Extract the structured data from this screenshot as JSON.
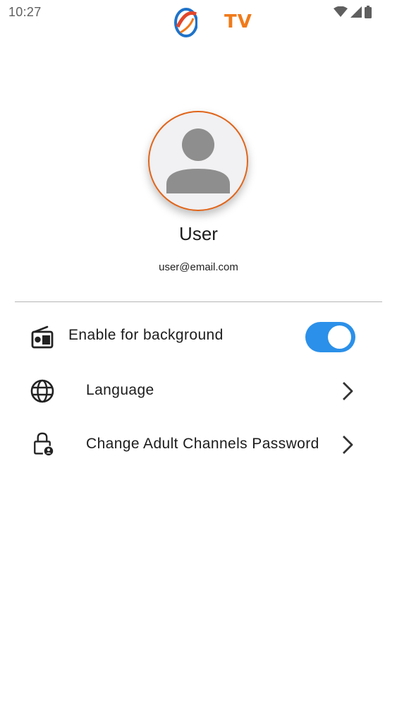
{
  "status_bar": {
    "time": "10:27"
  },
  "app": {
    "logo_text": "TV",
    "accent_color": "#f07a1a"
  },
  "profile": {
    "name": "User",
    "email": "user@email.com",
    "avatar_border_color": "#e0651a"
  },
  "settings": {
    "background": {
      "label": "Enable for background",
      "enabled": true,
      "icon": "radio-icon"
    },
    "language": {
      "label": "Language",
      "icon": "globe-icon"
    },
    "adult_password": {
      "label": "Change Adult Channels Password",
      "icon": "lock-person-icon"
    }
  },
  "colors": {
    "toggle_on": "#2b90e9"
  }
}
